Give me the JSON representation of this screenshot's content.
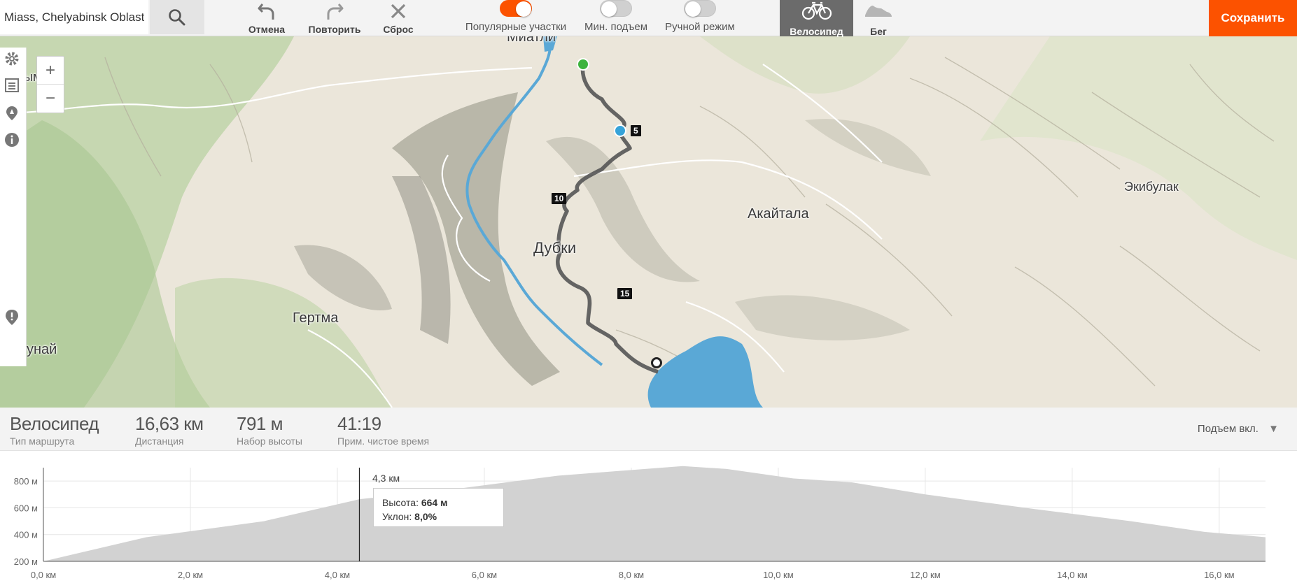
{
  "search": {
    "value": "Miass, Chelyabinsk Oblast",
    "icon": "search-icon"
  },
  "toolbar": {
    "undo_label": "Отмена",
    "redo_label": "Повторить",
    "reset_label": "Сброс",
    "toggles": {
      "popular": {
        "label": "Популярные участки",
        "on": true
      },
      "min_climb": {
        "label": "Мин. подъем",
        "on": false
      },
      "manual": {
        "label": "Ручной режим",
        "on": false
      }
    },
    "sport_bike": "Велосипед",
    "sport_run": "Бег",
    "save_label": "Сохранить",
    "accent": "#fc5200"
  },
  "map": {
    "places": {
      "miatli": "Миатли",
      "dubki": "Дубки",
      "akaitala": "Акайтала",
      "ekibulak": "Экибулак",
      "gertma": "Гертма",
      "chunai": "унай",
      "top_left": "ым"
    },
    "km_markers": [
      "5",
      "10",
      "15"
    ],
    "zoom_in": "+",
    "zoom_out": "−"
  },
  "stats": {
    "type": {
      "value": "Велосипед",
      "label": "Тип маршрута"
    },
    "distance": {
      "value": "16,63 км",
      "label": "Дистанция"
    },
    "climb": {
      "value": "791 м",
      "label": "Набор высоты"
    },
    "time": {
      "value": "41:19",
      "label": "Прим. чистое время"
    },
    "climb_select": "Подъем вкл."
  },
  "elevation": {
    "cursor_km": "4,3 км",
    "tooltip": {
      "height_label": "Высота:",
      "height_value": "664 м",
      "grade_label": "Уклон:",
      "grade_value": "8,0%"
    },
    "chart_data": {
      "type": "area",
      "x": [
        0,
        1.4,
        3.0,
        4.3,
        5.6,
        7.0,
        8.7,
        9.3,
        10.2,
        11.0,
        12.0,
        13.5,
        14.8,
        15.8,
        16.63
      ],
      "y": [
        200,
        380,
        500,
        664,
        740,
        840,
        912,
        890,
        820,
        790,
        700,
        590,
        500,
        420,
        380
      ],
      "x_ticks": [
        "0,0 км",
        "2,0 км",
        "4,0 км",
        "6,0 км",
        "8,0 км",
        "10,0 км",
        "12,0 км",
        "14,0 км",
        "16,0 км"
      ],
      "y_ticks": [
        "800 м",
        "600 м",
        "400 м",
        "200 м"
      ],
      "xlim": [
        0,
        16.63
      ],
      "ylim": [
        200,
        900
      ],
      "grid": true
    }
  }
}
